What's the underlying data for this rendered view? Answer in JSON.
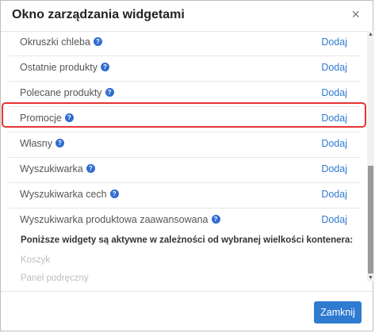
{
  "dialog": {
    "title": "Okno zarządzania widgetami",
    "close_glyph": "×"
  },
  "widgets": [
    {
      "label": "Okruszki chleba",
      "add": "Dodaj",
      "help_icon": "?"
    },
    {
      "label": "Ostatnie produkty",
      "add": "Dodaj",
      "help_icon": "?"
    },
    {
      "label": "Polecane produkty",
      "add": "Dodaj",
      "help_icon": "?"
    },
    {
      "label": "Promocje",
      "add": "Dodaj",
      "help_icon": "?"
    },
    {
      "label": "Własny",
      "add": "Dodaj",
      "help_icon": "?"
    },
    {
      "label": "Wyszukiwarka",
      "add": "Dodaj",
      "help_icon": "?"
    },
    {
      "label": "Wyszukiwarka cech",
      "add": "Dodaj",
      "help_icon": "?"
    },
    {
      "label": "Wyszukiwarka produktowa zaawansowana",
      "add": "Dodaj",
      "help_icon": "?"
    }
  ],
  "info": {
    "heading": "Poniższe widgety są aktywne w zależności od wybranej wielkości kontenera:",
    "inactive_items": [
      "Koszyk",
      "Panel podręczny"
    ]
  },
  "footer": {
    "close_button": "Zamknij"
  },
  "colors": {
    "accent": "#2f7bd0",
    "help_icon": "#2f6bd1",
    "highlight": "#e53333"
  },
  "icons": {
    "help": "question-circle-icon",
    "close": "close-icon"
  }
}
